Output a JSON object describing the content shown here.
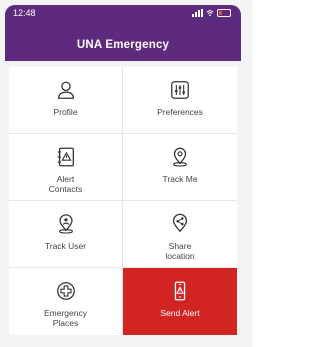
{
  "status_bar": {
    "time": "12:48"
  },
  "header": {
    "title": "UNA Emergency"
  },
  "tiles": [
    {
      "label": "Profile",
      "icon": "profile-icon"
    },
    {
      "label": "Preferences",
      "icon": "preferences-icon"
    },
    {
      "label": "Alert\nContacts",
      "icon": "alert-contacts-icon"
    },
    {
      "label": "Track Me",
      "icon": "track-me-icon"
    },
    {
      "label": "Track User",
      "icon": "track-user-icon"
    },
    {
      "label": "Share\nlocation",
      "icon": "share-location-icon"
    },
    {
      "label": "Emergency\nPlaces",
      "icon": "emergency-places-icon"
    },
    {
      "label": "Send Alert",
      "icon": "send-alert-icon"
    }
  ],
  "colors": {
    "header": "#5e2a7e",
    "alert": "#d32424"
  }
}
